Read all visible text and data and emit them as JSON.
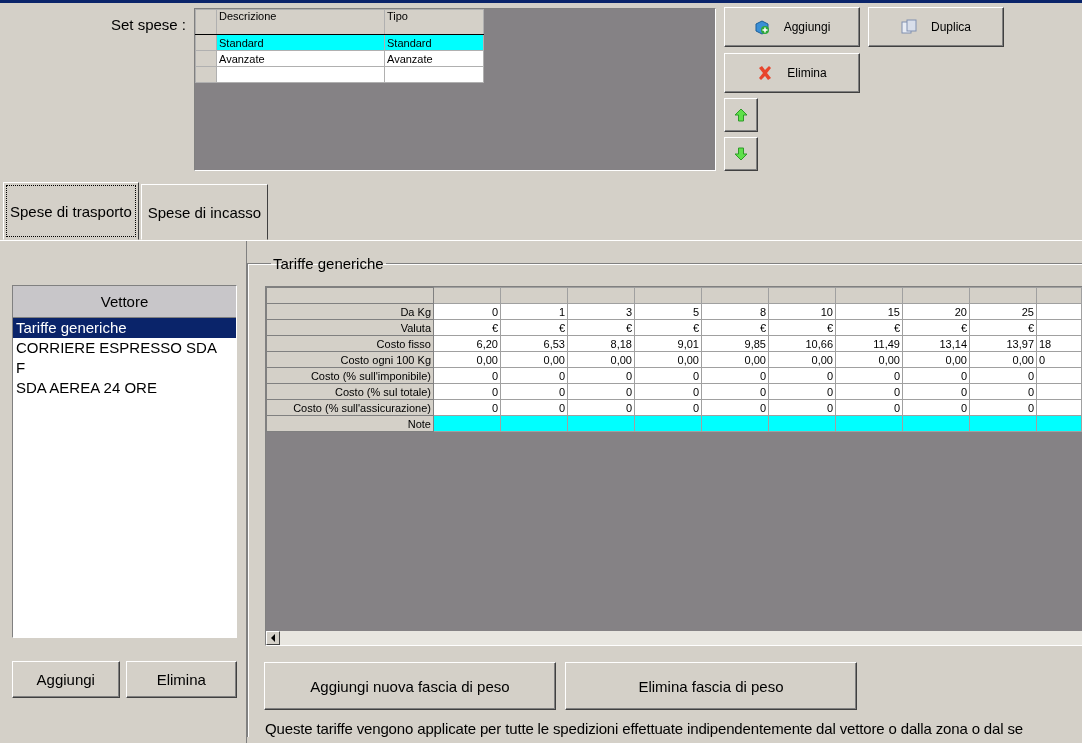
{
  "set_spese": {
    "label": "Set spese :",
    "columns": [
      "Descrizione",
      "Tipo"
    ],
    "rows": [
      {
        "cells": [
          "Standard",
          "Standard"
        ],
        "selected": true
      },
      {
        "cells": [
          "Avanzate",
          "Avanzate"
        ],
        "selected": false
      }
    ]
  },
  "set_buttons": [
    {
      "kind": "add",
      "label": "Aggiungi"
    },
    {
      "kind": "duplicate",
      "label": "Duplica"
    },
    {
      "kind": "delete",
      "label": "Elimina"
    },
    {
      "kind": "up"
    },
    {
      "kind": "down"
    }
  ],
  "tabs": [
    {
      "label": "Spese di trasporto",
      "selected": true
    },
    {
      "label": "Spese di incasso",
      "selected": false
    }
  ],
  "vettore": {
    "header": "Vettore",
    "items": [
      {
        "lines": [
          "Tariffe generiche"
        ],
        "selected": true
      },
      {
        "lines": [
          "CORRIERE ESPRESSO SDA",
          "F"
        ],
        "selected": false
      },
      {
        "lines": [
          "SDA AEREA 24 ORE"
        ],
        "selected": false
      }
    ]
  },
  "vettore_buttons": [
    "Aggiungi",
    "Elimina"
  ],
  "tariffe": {
    "title": "Tariffe generiche",
    "rows": [
      {
        "label": "Da Kg",
        "values": [
          "0",
          "1",
          "3",
          "5",
          "8",
          "10",
          "15",
          "20",
          "25"
        ],
        "selected": false
      },
      {
        "label": "Valuta",
        "values": [
          "€",
          "€",
          "€",
          "€",
          "€",
          "€",
          "€",
          "€",
          "€"
        ],
        "selected": false
      },
      {
        "label": "Costo fisso",
        "values": [
          "6,20",
          "6,53",
          "8,18",
          "9,01",
          "9,85",
          "10,66",
          "11,49",
          "13,14",
          "13,97",
          "18"
        ],
        "selected": false
      },
      {
        "label": "Costo ogni 100 Kg",
        "values": [
          "0,00",
          "0,00",
          "0,00",
          "0,00",
          "0,00",
          "0,00",
          "0,00",
          "0,00",
          "0,00",
          "0"
        ],
        "selected": false
      },
      {
        "label": "Costo (% sull'imponibile)",
        "values": [
          "0",
          "0",
          "0",
          "0",
          "0",
          "0",
          "0",
          "0",
          "0"
        ],
        "selected": false
      },
      {
        "label": "Costo (% sul totale)",
        "values": [
          "0",
          "0",
          "0",
          "0",
          "0",
          "0",
          "0",
          "0",
          "0"
        ],
        "selected": false
      },
      {
        "label": "Costo (% sull'assicurazione)",
        "values": [
          "0",
          "0",
          "0",
          "0",
          "0",
          "0",
          "0",
          "0",
          "0"
        ],
        "selected": false
      },
      {
        "label": "Note",
        "values": [],
        "selected": true
      }
    ]
  },
  "fascia_buttons": [
    "Aggiungi nuova fascia di peso",
    "Elimina fascia di peso"
  ],
  "note_text": "Queste tariffe vengono applicate per tutte le spedizioni effettuate indipendentemente dal vettore o dalla zona o dal se"
}
